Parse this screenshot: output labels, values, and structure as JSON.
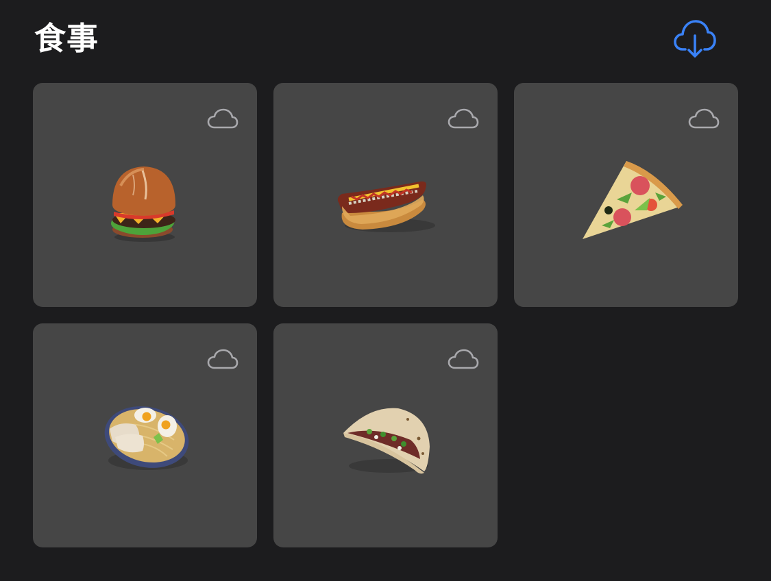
{
  "header": {
    "title": "食事",
    "download_icon": "cloud-download-icon",
    "accent_color": "#3a82f7"
  },
  "items": [
    {
      "food": "hamburger",
      "icon": "cloud-icon",
      "downloaded": false
    },
    {
      "food": "hot-dog",
      "icon": "cloud-icon",
      "downloaded": false
    },
    {
      "food": "pizza-slice",
      "icon": "cloud-icon",
      "downloaded": false
    },
    {
      "food": "ramen-bowl",
      "icon": "cloud-icon",
      "downloaded": false
    },
    {
      "food": "taco",
      "icon": "cloud-icon",
      "downloaded": false
    }
  ]
}
